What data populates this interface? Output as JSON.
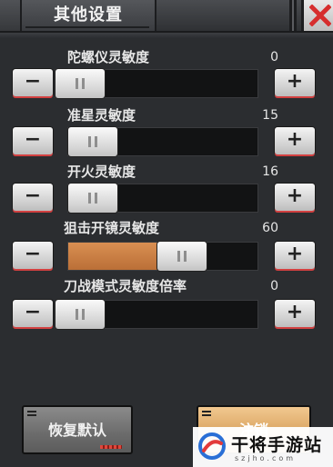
{
  "window": {
    "title": "其他设置"
  },
  "sliders": [
    {
      "label": "陀螺仪灵敏度",
      "value": "0",
      "fill_fraction": 0.0
    },
    {
      "label": "准星灵敏度",
      "value": "15",
      "fill_fraction": 0.0
    },
    {
      "label": "开火灵敏度",
      "value": "16",
      "fill_fraction": 0.0
    },
    {
      "label": "狙击开镜灵敏度",
      "value": "60",
      "fill_fraction": 0.46
    },
    {
      "label": "刀战模式灵敏度倍率",
      "value": "0",
      "fill_fraction": 0.0
    }
  ],
  "buttons": {
    "minus": "−",
    "plus": "+",
    "reset": "恢复默认",
    "cancel": "注销"
  },
  "watermark": {
    "brand": "干将手游站",
    "url": "szjho.com"
  },
  "colors": {
    "accent_orange": "#d98f52",
    "close_red": "#d62e2e",
    "underline_red": "#d34040"
  }
}
